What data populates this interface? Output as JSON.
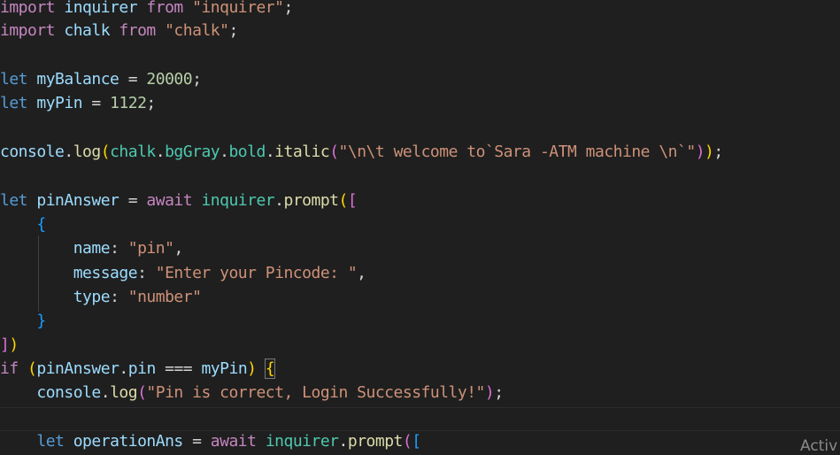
{
  "editor": {
    "language": "typescript",
    "colors": {
      "background": "#1f1f1f",
      "keyword": "#569cd6",
      "control": "#c586c0",
      "variable": "#9cdcfe",
      "function": "#dcdcaa",
      "string": "#ce9178",
      "number": "#b5cea8"
    },
    "lines": {
      "l1": {
        "kw": "import",
        "a": " inquirer ",
        "from": "from",
        "b": " ",
        "str": "\"inquirer\"",
        "end": ";"
      },
      "l2": {
        "kw": "import",
        "a": " chalk ",
        "from": "from",
        "b": " ",
        "str": "\"chalk\"",
        "end": ";"
      },
      "l4": {
        "kw": "let",
        "a": " ",
        "var": "myBalance",
        "b": " = ",
        "num": "20000",
        "end": ";"
      },
      "l5": {
        "kw": "let",
        "a": " ",
        "var": "myPin",
        "b": " = ",
        "num": "1122",
        "end": ";"
      },
      "l7": {
        "obj": "console",
        "dot1": ".",
        "fn1": "log",
        "p1": "(",
        "chalk": "chalk",
        "dot2": ".",
        "bg": "bgGray",
        "dot3": ".",
        "bold": "bold",
        "dot4": ".",
        "fn2": "italic",
        "p2": "(",
        "str": "\"\\n\\t welcome to`Sara -ATM machine \\n`\"",
        "p3": ")",
        "p4": ")",
        "end": ";"
      },
      "l9": {
        "kw": "let",
        "a": " ",
        "var": "pinAnswer",
        "b": " = ",
        "await": "await",
        "c": " ",
        "obj": "inquirer",
        "dot": ".",
        "fn": "prompt",
        "p1": "(",
        "p2": "["
      },
      "l10": {
        "indent": "    ",
        "brace": "{"
      },
      "l11": {
        "indent": "        ",
        "key": "name",
        "colon": ": ",
        "str": "\"pin\"",
        "end": ","
      },
      "l12": {
        "indent": "        ",
        "key": "message",
        "colon": ": ",
        "str": "\"Enter your Pincode: \"",
        "end": ","
      },
      "l13": {
        "indent": "        ",
        "key": "type",
        "colon": ": ",
        "str": "\"number\""
      },
      "l14": {
        "indent": "    ",
        "brace": "}"
      },
      "l15": {
        "p1": "]",
        "p2": ")"
      },
      "l16": {
        "if": "if",
        "a": " ",
        "p1": "(",
        "var1": "pinAnswer",
        "dot": ".",
        "var2": "pin",
        "op": " === ",
        "var3": "myPin",
        "p2": ")",
        "b": " ",
        "brace": "{"
      },
      "l17": {
        "indent": "    ",
        "obj": "console",
        "dot": ".",
        "fn": "log",
        "p1": "(",
        "str": "\"Pin is correct, Login Successfully!\"",
        "p2": ")",
        "end": ";"
      },
      "l19": {
        "indent": "    ",
        "kw": "let",
        "a": " ",
        "var": "operationAns",
        "b": " = ",
        "await": "await",
        "c": " ",
        "obj": "inquirer",
        "dot": ".",
        "fn": "prompt",
        "p1": "(",
        "p2": "["
      }
    }
  },
  "watermark": {
    "text": "Activ"
  }
}
